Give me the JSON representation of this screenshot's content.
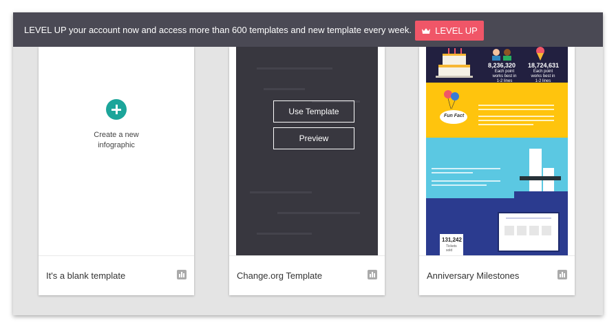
{
  "banner": {
    "message": "LEVEL UP your account now and access more than 600 templates and new template every week.",
    "button_label": "LEVEL UP",
    "button_icon": "crown-icon",
    "button_color": "#f05668",
    "background": "#4a4954"
  },
  "cards": [
    {
      "title": "It's a blank template",
      "create_label_line1": "Create a new",
      "create_label_line2": "infographic",
      "icon": "stats-icon"
    },
    {
      "title": "Change.org Template",
      "use_label": "Use Template",
      "preview_label": "Preview",
      "icon": "stats-icon"
    },
    {
      "title": "Anniversary Milestones",
      "icon": "stats-icon",
      "preview": {
        "stat_a": "8,236,320",
        "stat_b": "18,724,631",
        "fun_fact": "Fun Fact",
        "counter": "131,242",
        "counter_caption": "Tickets sold"
      }
    }
  ],
  "accent_color": "#1ca59a"
}
